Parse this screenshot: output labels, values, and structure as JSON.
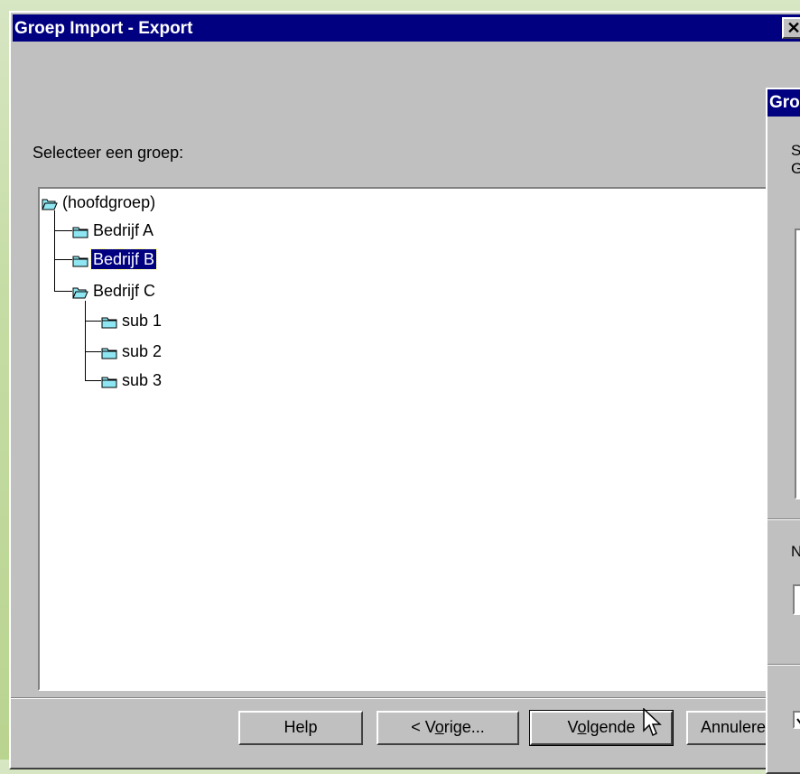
{
  "window": {
    "title": "Groep Import - Export",
    "close_label": "✕"
  },
  "main": {
    "select_label": "Selecteer een groep:",
    "tree": {
      "root": "(hoofdgroep)",
      "children": [
        "Bedrijf A",
        "Bedrijf B",
        "Bedrijf C"
      ],
      "selected": "Bedrijf B",
      "sub_children": [
        "sub 1",
        "sub 2",
        "sub 3"
      ]
    }
  },
  "buttons": {
    "help": "Help",
    "back_prefix": "< V",
    "back_u": "o",
    "back_suffix": "rige...",
    "next_prefix": "V",
    "next_u": "o",
    "next_suffix": "lgende",
    "cancel": "Annuleren"
  },
  "second_dialog": {
    "title": "Groep",
    "line1": "S",
    "line2": "G",
    "label": "N"
  },
  "colors": {
    "titlebar": "#000080",
    "dialog_bg": "#c0c0c0",
    "selection": "#000080",
    "folder_fill": "#8ee6f2"
  },
  "icons": [
    "folder-open-icon",
    "folder-closed-icon",
    "close-icon",
    "mouse-cursor-icon"
  ]
}
